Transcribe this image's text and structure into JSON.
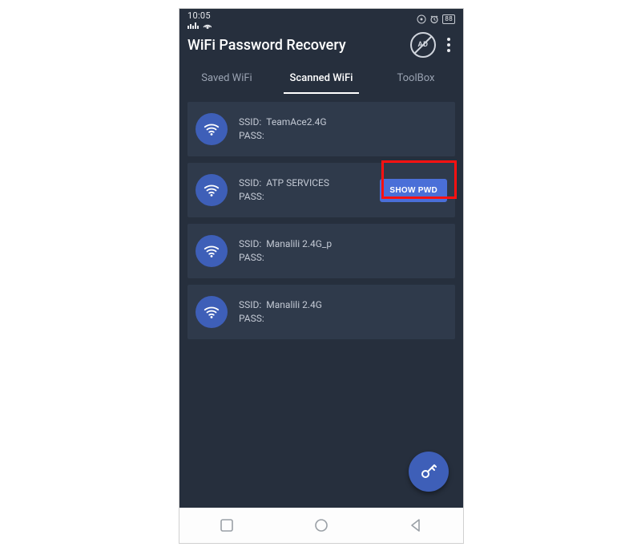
{
  "statusbar": {
    "time": "10:05",
    "battery": "88"
  },
  "appbar": {
    "title": "WiFi Password Recovery",
    "ad_label": "AD"
  },
  "tabs": {
    "saved": "Saved WiFi",
    "scanned": "Scanned WiFi",
    "toolbox": "ToolBox",
    "active_index": 1
  },
  "labels": {
    "ssid": "SSID:",
    "pass": "PASS:",
    "show_pwd": "SHOW PWD"
  },
  "networks": [
    {
      "ssid": "TeamAce2.4G",
      "pass": "",
      "show_button": false
    },
    {
      "ssid": "ATP SERVICES",
      "pass": "",
      "show_button": true
    },
    {
      "ssid": "Manalili 2.4G_p",
      "pass": "",
      "show_button": false
    },
    {
      "ssid": "Manalili 2.4G",
      "pass": "",
      "show_button": false
    }
  ]
}
